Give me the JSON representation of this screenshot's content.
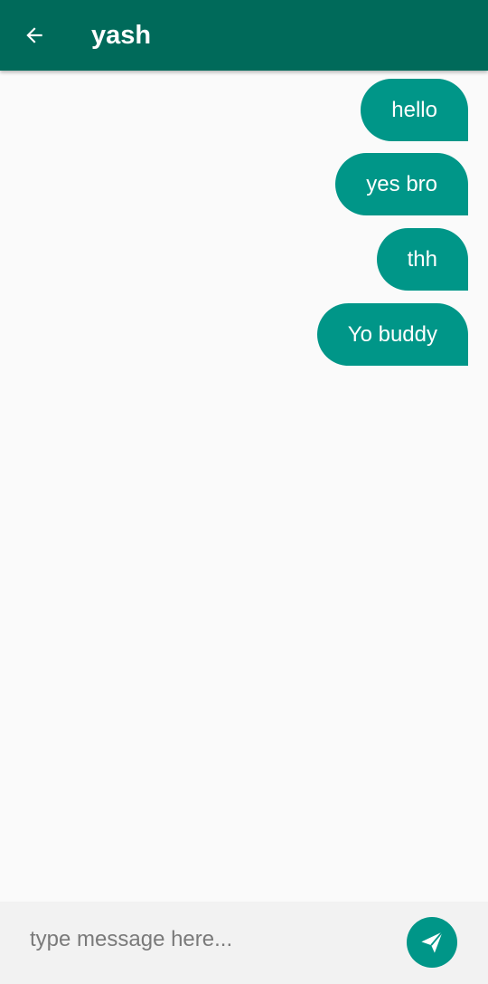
{
  "appbar": {
    "title": "yash",
    "back_icon": "arrow-left-icon",
    "color": "#006a5a"
  },
  "messages": [
    {
      "text": "hello",
      "sender": "me"
    },
    {
      "text": "yes bro",
      "sender": "me"
    },
    {
      "text": "thh",
      "sender": "me"
    },
    {
      "text": "Yo buddy",
      "sender": "me"
    }
  ],
  "composer": {
    "placeholder": "type message here...",
    "value": "",
    "send_icon": "send-icon",
    "accent": "#009688"
  }
}
